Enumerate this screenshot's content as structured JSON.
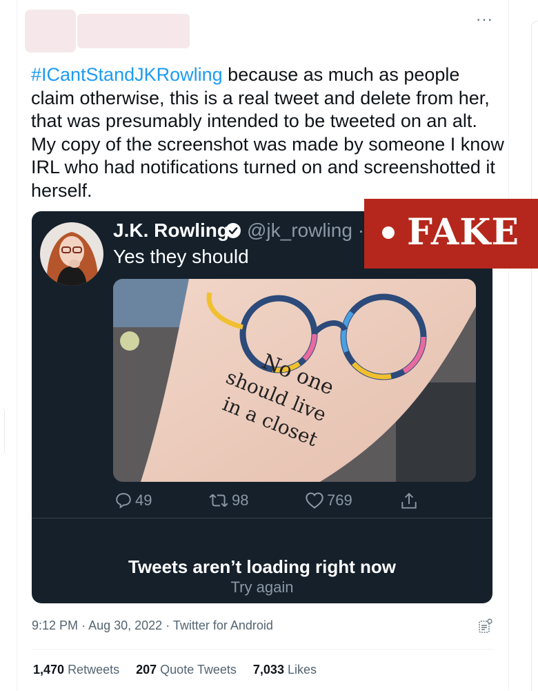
{
  "tweet": {
    "menu_glyph": "···",
    "hashtag": "#ICantStandJKRowling",
    "body": " because as much as people claim otherwise, this is a real tweet and delete from her, that was presumably intended to be tweeted on an alt. My copy of the screenshot was made by someone I know IRL who had notifications turned on and screenshotted it herself."
  },
  "embedded_tweet": {
    "name": "J.K. Rowling",
    "handle": "@jk_rowling · 1",
    "text": "Yes they should",
    "tattoo_lines": [
      "No one",
      "should live",
      "in a closet"
    ],
    "replies": "49",
    "retweets": "98",
    "likes": "769",
    "status_title": "Tweets aren’t loading right now",
    "status_action": "Try again"
  },
  "fake_label": {
    "text": "FAKE",
    "color": "#b5271c"
  },
  "meta": {
    "time": "9:12 PM",
    "date": "Aug 30, 2022",
    "source": "Twitter for Android"
  },
  "stats": {
    "retweets_count": "1,470",
    "retweets_label": "Retweets",
    "quotes_count": "207",
    "quotes_label": "Quote Tweets",
    "likes_count": "7,033",
    "likes_label": "Likes"
  }
}
